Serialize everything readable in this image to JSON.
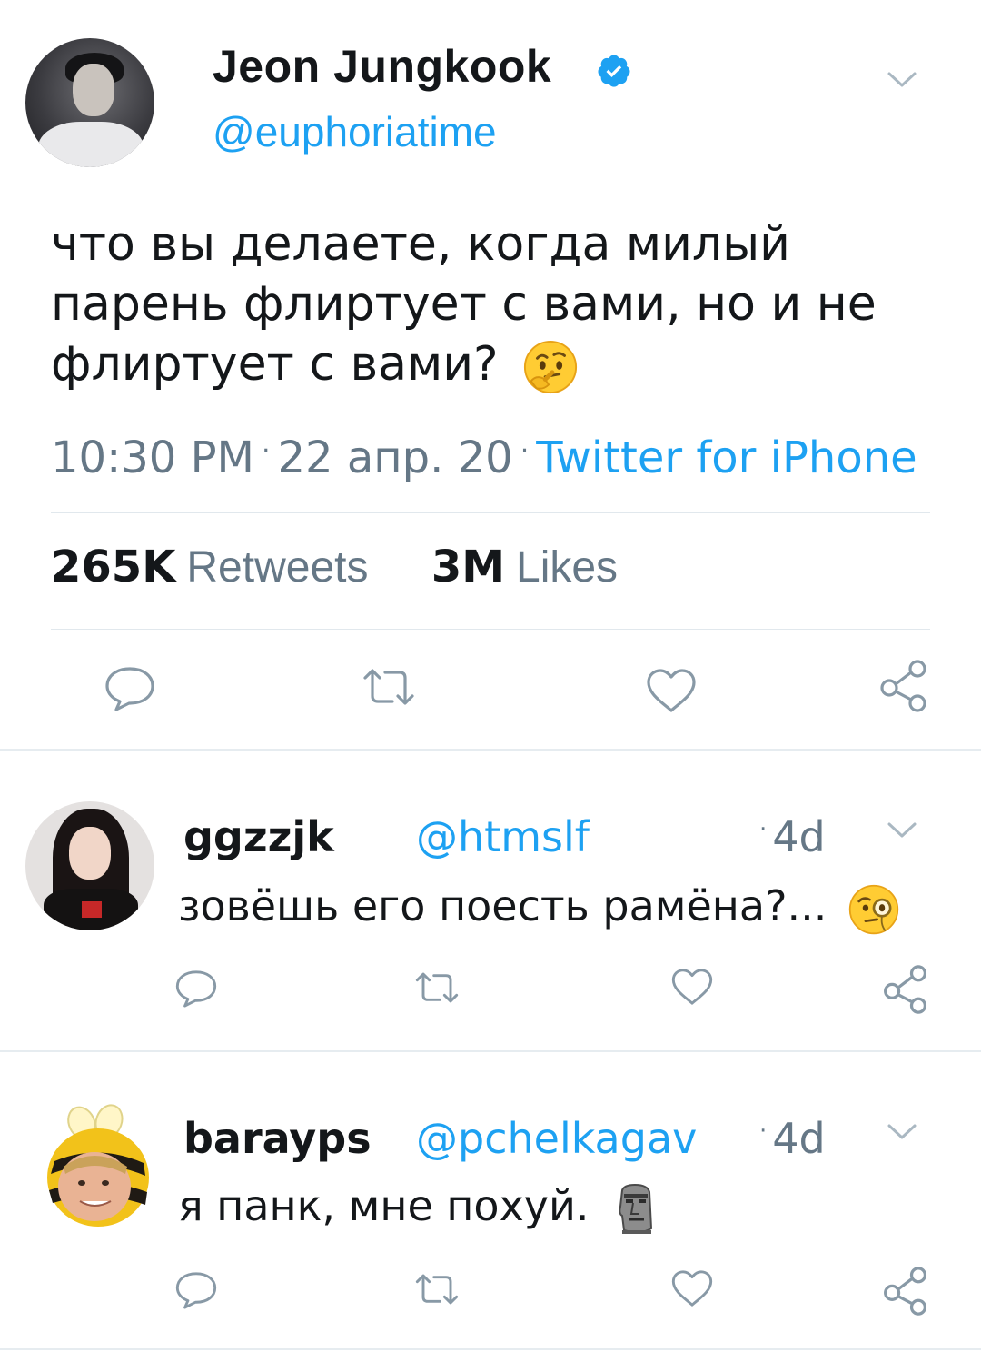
{
  "tweet": {
    "display_name": "Jeon Jungkook",
    "handle": "@euphoriatime",
    "verified_icon": "verified-badge-icon",
    "text_lines": [
      "что вы делаете, когда милый",
      "парень флиртует с вами, но и не",
      "флиртует с вами?"
    ],
    "emoji": "thinking-face",
    "time": "10:30 PM",
    "date": "22 апр. 20",
    "source": "Twitter for iPhone",
    "separator": "·",
    "retweets_count": "265K",
    "retweets_label": "Retweets",
    "likes_count": "3M",
    "likes_label": "Likes"
  },
  "actions": [
    "reply-icon",
    "retweet-icon",
    "like-icon",
    "share-icon"
  ],
  "replies": [
    {
      "name": "ggzzjk",
      "handle": "@htmslf",
      "time": "4d",
      "text": "зовёшь его поесть рамёна?...",
      "emoji": "face-with-monocle"
    },
    {
      "name": "barayps",
      "handle": "@pchelkagav",
      "time": "4d",
      "text": "я панк, мне похуй.",
      "emoji": "moai"
    }
  ],
  "colors": {
    "link": "#1da1f2",
    "secondary_text": "#657786",
    "icon": "#657786",
    "divider": "#e1e8ed"
  }
}
